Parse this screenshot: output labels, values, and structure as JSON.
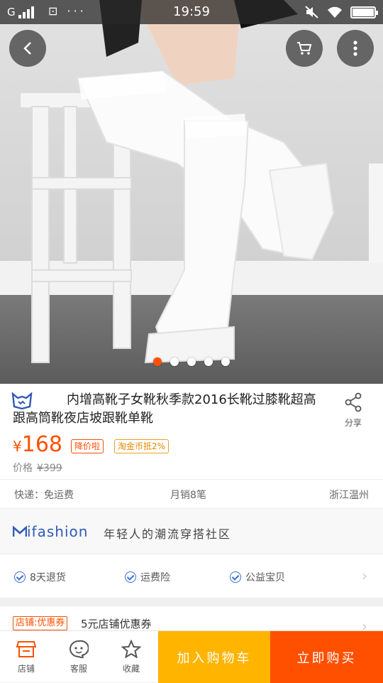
{
  "status_bar": {
    "carrier": "G",
    "extra": "⊡ ···",
    "time": "19:59"
  },
  "hero": {
    "dots_count": 5,
    "active_dot": 0
  },
  "product": {
    "title": "内增高靴子女靴秋季款2016长靴过膝靴超高跟高筒靴夜店坡跟靴单靴",
    "share_label": "分享",
    "currency": "¥",
    "price": "168",
    "tag_discount": "降价啦",
    "tag_commission": "淘金币抵2%",
    "orig_label": "价格",
    "orig_price": "¥399",
    "shipping": "快递：免运费",
    "monthly_sales": "月销8笔",
    "location": "浙江温州"
  },
  "ifashion": {
    "brand": "ifashion",
    "slogan": "年轻人的潮流穿搭社区"
  },
  "guarantees": [
    "8天退货",
    "运费险",
    "公益宝贝"
  ],
  "coupon": {
    "tag": "店铺:优惠券",
    "text": "5元店铺优惠券"
  },
  "bottom_bar": {
    "shop": "店铺",
    "service": "客服",
    "favorite": "收藏",
    "add_to_cart": "加入购物车",
    "buy_now": "立即购买"
  },
  "colors": {
    "accent": "#ff5000",
    "cart": "#ffb400",
    "brand_blue": "#2f5bb7"
  }
}
